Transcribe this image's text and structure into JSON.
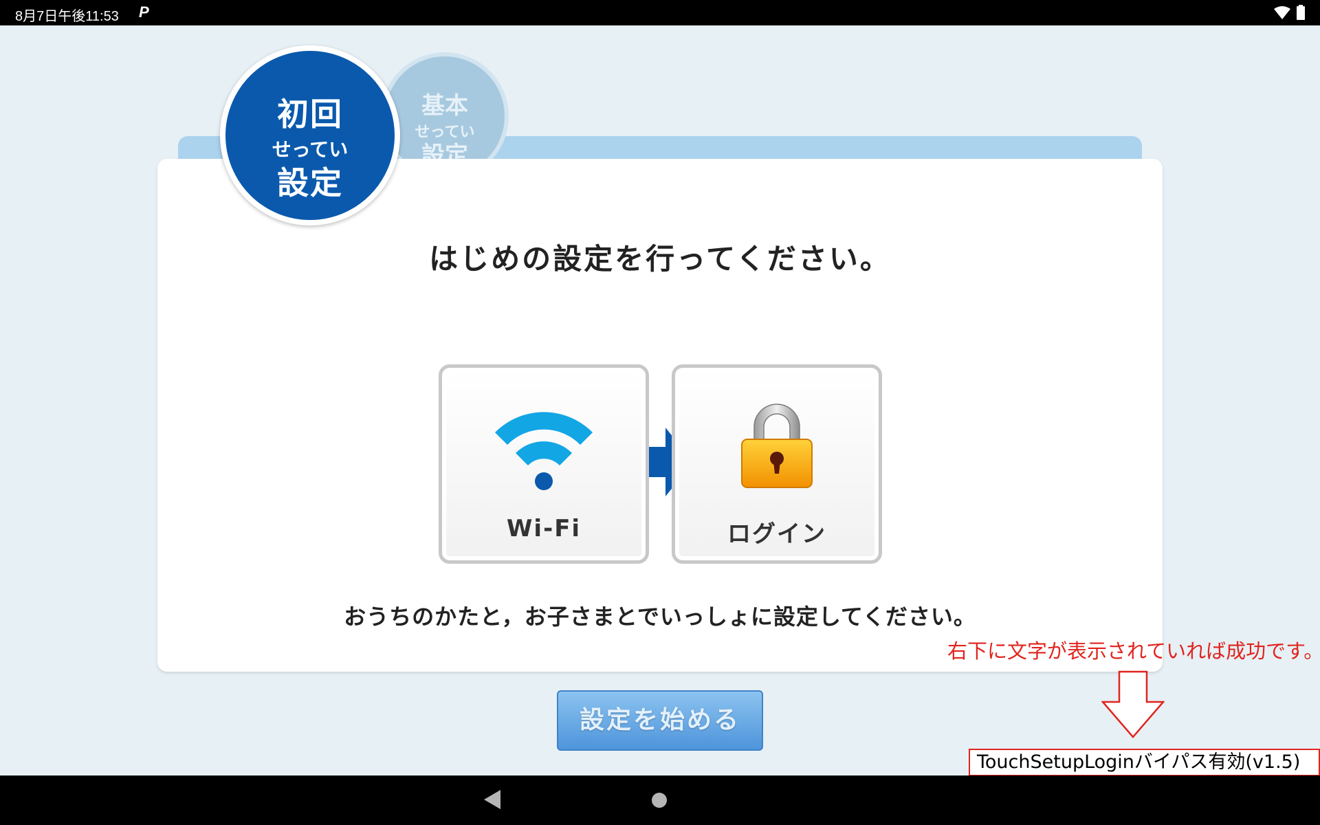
{
  "status_bar": {
    "time": "8月7日午後11:53",
    "app_indicator": "P",
    "icons": [
      "wifi-icon",
      "battery-icon"
    ]
  },
  "tabs": {
    "initial": {
      "line1": "初回",
      "reading": "せってい",
      "line2": "設定",
      "active": true
    },
    "basic": {
      "line1": "基本",
      "reading": "せってい",
      "line2": "設定",
      "active": false
    }
  },
  "main": {
    "heading": "はじめの設定を行ってください。",
    "steps": [
      {
        "label": "Wi-Fi",
        "icon": "wifi-icon"
      },
      {
        "label": "ログイン",
        "icon": "padlock-icon"
      }
    ],
    "subtext": "おうちのかたと，お子さまとでいっしょに設定してください。",
    "start_button": "設定を始める"
  },
  "overlay": {
    "note": "右下に文字が表示されていれば成功です。",
    "bypass_text": "TouchSetupLoginバイパス有効(v1.5)"
  },
  "nav_bar": {
    "icons": [
      "back-icon",
      "home-icon"
    ]
  },
  "colors": {
    "background": "#e7f0f5",
    "active_tab": "#0a59ad",
    "inactive_tab": "#a7c9df",
    "wifi_icon": "#12a6e4",
    "arrow": "#0a59ad",
    "padlock": "#f5a800",
    "button": "#5a9fe0",
    "note_red": "#e0241e"
  }
}
